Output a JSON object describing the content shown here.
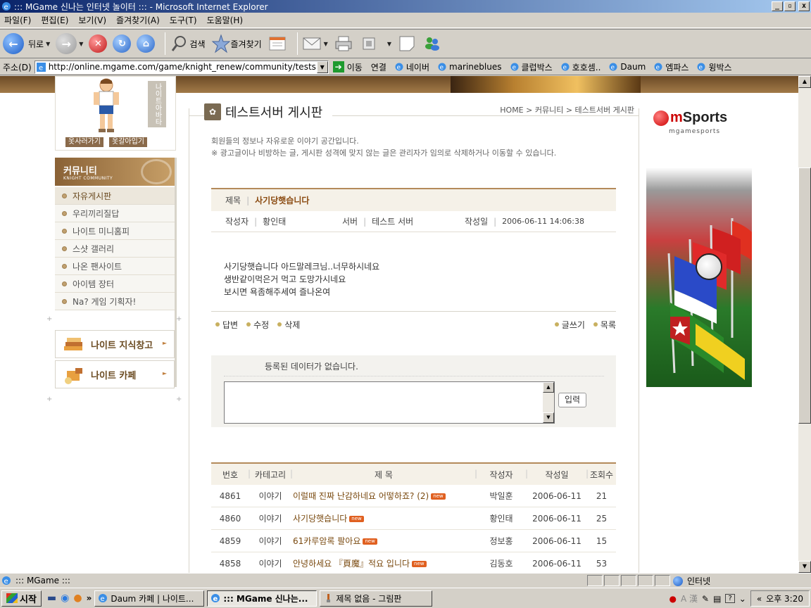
{
  "window": {
    "title": "::: MGame 신나는 인터넷 놀이터 ::: - Microsoft Internet Explorer",
    "min_label": "_",
    "max_label": "▫",
    "close_label": "x"
  },
  "menu": [
    "파일(F)",
    "편집(E)",
    "보기(V)",
    "즐겨찾기(A)",
    "도구(T)",
    "도움말(H)"
  ],
  "toolbar": {
    "back_label": "뒤로",
    "search_label": "검색",
    "favorites_label": "즐겨찾기"
  },
  "address": {
    "label": "주소(D)",
    "url": "http://online.mgame.com/game/knight_renew/community/testserv",
    "go_label": "이동",
    "links_label": "연결",
    "links": [
      "네이버",
      "marineblues",
      "클럽박스",
      "호호셈..",
      "Daum",
      "엠파스",
      "윙박스"
    ]
  },
  "sidebar": {
    "avatar_side_label": "나이트아바타",
    "avatar_buttons": [
      "옷사러가기",
      "옷갈아입기"
    ],
    "community_title": "커뮤니티",
    "community_subtitle": "KNIGHT COMMUNITY",
    "items": [
      "자유게시판",
      "우리끼리질답",
      "나이트 미니홈피",
      "스샷 갤러리",
      "나온 팬사이트",
      "아이템 장터",
      "Na? 게임 기획자!"
    ],
    "banners": [
      "나이트 지식창고",
      "나이트 카페"
    ]
  },
  "board": {
    "title": "테스트서버 게시판",
    "breadcrumb": "HOME > 커뮤니티 > 테스트서버 게시판",
    "desc_line1": "회원들의 정보나 자유로운 이야기 공간입니다.",
    "desc_line2": "※ 광고글이나 비방하는 글, 게시판 성격에 맞지 않는 글은 관리자가 임의로 삭제하거나 이동할 수 있습니다."
  },
  "post": {
    "subject_label": "제목",
    "subject": "사기당햇습니다",
    "author_label": "작성자",
    "author": "황인태",
    "server_label": "서버",
    "server": "테스트 서버",
    "date_label": "작성일",
    "date": "2006-06-11 14:06:38",
    "body": [
      "사기당햇습니다 아드말레크님..너무하시네요",
      "생반같이먹은거 먹고 도망가시네요",
      "보시면 욕좀해주세여 즐나온여"
    ],
    "actions_left": [
      "답변",
      "수정",
      "삭제"
    ],
    "actions_right": [
      "글쓰기",
      "목록"
    ]
  },
  "comments": {
    "empty_text": "등록된 데이터가 없습니다.",
    "submit_label": "입력"
  },
  "list": {
    "headers": [
      "번호",
      "카테고리",
      "제 목",
      "작성자",
      "작성일",
      "조회수"
    ],
    "new_badge": "new",
    "rows": [
      {
        "no": "4861",
        "cat": "이야기",
        "subj": "이럴때 진짜 난감하네요 어떻하죠? (2)",
        "auth": "박일훈",
        "date": "2006-06-11",
        "views": "21"
      },
      {
        "no": "4860",
        "cat": "이야기",
        "subj": "사기당햇습니다",
        "auth": "황인태",
        "date": "2006-06-11",
        "views": "25"
      },
      {
        "no": "4859",
        "cat": "이야기",
        "subj": "61카루암록 팔아요",
        "auth": "정보홍",
        "date": "2006-06-11",
        "views": "15"
      },
      {
        "no": "4858",
        "cat": "이야기",
        "subj": "안녕하세요 『頁魔』적요 입니다",
        "auth": "김동호",
        "date": "2006-06-11",
        "views": "53"
      }
    ]
  },
  "ad": {
    "logo_m": "m",
    "logo_rest": "Sports",
    "sub": "mgamesports"
  },
  "status": {
    "text": "::: MGame :::",
    "zone": "인터넷"
  },
  "taskbar": {
    "start": "시작",
    "tasks": [
      "Daum 카페 | 나이트...",
      "::: MGame 신나는...",
      "제목 없음 - 그림판"
    ],
    "clock": "오후 3:20",
    "ime": "A 漢"
  },
  "colors": {
    "accent_brown": "#b48a5a",
    "title_text": "#8a4a10",
    "titlebar": "#0a246a"
  }
}
